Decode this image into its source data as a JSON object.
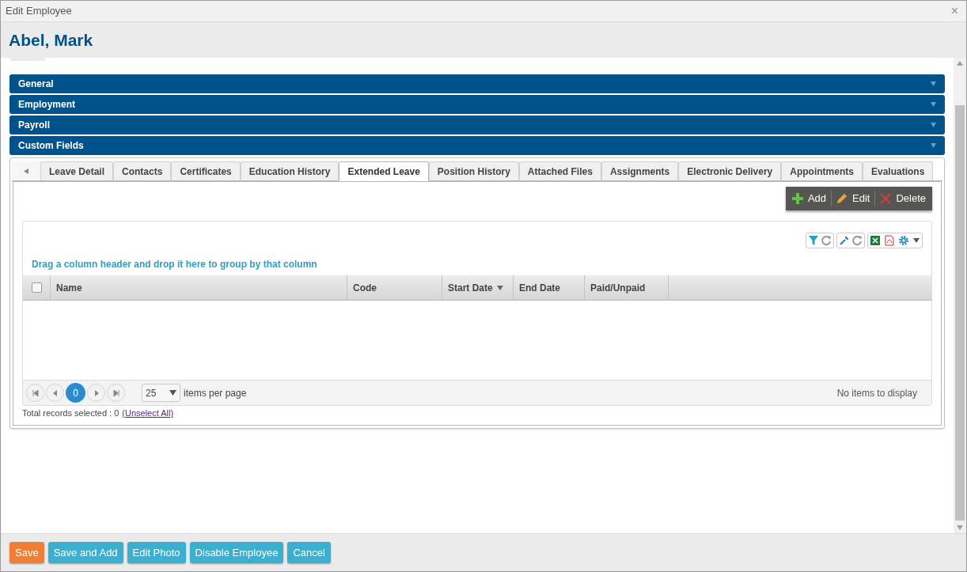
{
  "window": {
    "title": "Edit Employee",
    "close": "×"
  },
  "employee_name": "Abel, Mark",
  "sections": [
    {
      "label": "General",
      "expanded": false
    },
    {
      "label": "Employment",
      "expanded": false
    },
    {
      "label": "Payroll",
      "expanded": false
    },
    {
      "label": "Custom Fields",
      "expanded": false
    }
  ],
  "tabs": [
    {
      "label": "Leave Detail",
      "selected": false
    },
    {
      "label": "Contacts",
      "selected": false
    },
    {
      "label": "Certificates",
      "selected": false
    },
    {
      "label": "Education History",
      "selected": false
    },
    {
      "label": "Extended Leave",
      "selected": true
    },
    {
      "label": "Position History",
      "selected": false
    },
    {
      "label": "Attached Files",
      "selected": false
    },
    {
      "label": "Assignments",
      "selected": false
    },
    {
      "label": "Electronic Delivery",
      "selected": false
    },
    {
      "label": "Appointments",
      "selected": false
    },
    {
      "label": "Evaluations",
      "selected": false
    }
  ],
  "actions": [
    {
      "kind": "add",
      "label": "Add"
    },
    {
      "kind": "edit",
      "label": "Edit"
    },
    {
      "kind": "delete",
      "label": "Delete"
    }
  ],
  "grid": {
    "group_hint": "Drag a column header and drop it here to group by that column",
    "select_all_checked": false,
    "columns": [
      {
        "label": "Name",
        "sorted": false
      },
      {
        "label": "Code",
        "sorted": false
      },
      {
        "label": "Start Date",
        "sorted": true
      },
      {
        "label": "End Date",
        "sorted": false
      },
      {
        "label": "Paid/Unpaid",
        "sorted": false
      }
    ],
    "pager": {
      "current_page": "0",
      "page_size": "25",
      "page_size_label": "items per page",
      "status": "No items to display"
    },
    "selection_text": "Total records selected : 0",
    "unselect_link": "(Unselect All)"
  },
  "buttons": [
    {
      "label": "Save",
      "kind": "primary"
    },
    {
      "label": "Save and Add",
      "kind": "secondary"
    },
    {
      "label": "Edit Photo",
      "kind": "secondary"
    },
    {
      "label": "Disable Employee",
      "kind": "secondary"
    },
    {
      "label": "Cancel",
      "kind": "secondary"
    }
  ]
}
